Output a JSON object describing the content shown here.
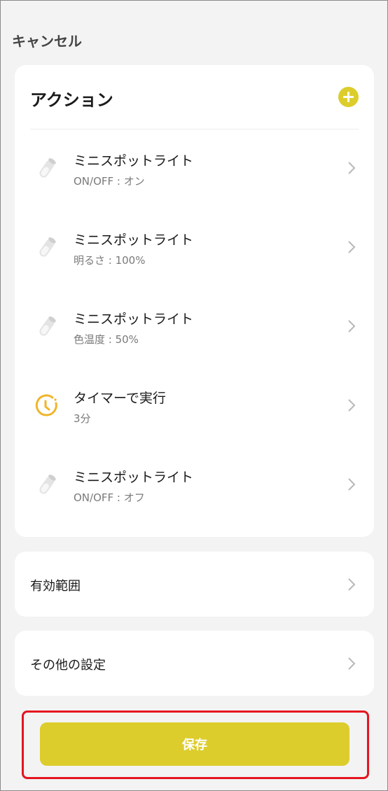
{
  "header": {
    "cancel_label": "キャンセル"
  },
  "actions": {
    "title": "アクション",
    "items": [
      {
        "title": "ミニスポットライト",
        "subtitle": "ON/OFF : オン",
        "icon": "spotlight-icon"
      },
      {
        "title": "ミニスポットライト",
        "subtitle": "明るさ : 100%",
        "icon": "spotlight-icon"
      },
      {
        "title": "ミニスポットライト",
        "subtitle": "色温度 : 50%",
        "icon": "spotlight-icon"
      },
      {
        "title": "タイマーで実行",
        "subtitle": "3分",
        "icon": "timer-icon"
      },
      {
        "title": "ミニスポットライト",
        "subtitle": "ON/OFF : オフ",
        "icon": "spotlight-icon"
      }
    ]
  },
  "effective_range": {
    "label": "有効範囲"
  },
  "other_settings": {
    "label": "その他の設定"
  },
  "save": {
    "label": "保存"
  },
  "colors": {
    "accent": "#dccd2c",
    "timer_icon": "#f0b52a",
    "highlight_border": "#e4151f",
    "background": "#f3f3f3"
  }
}
